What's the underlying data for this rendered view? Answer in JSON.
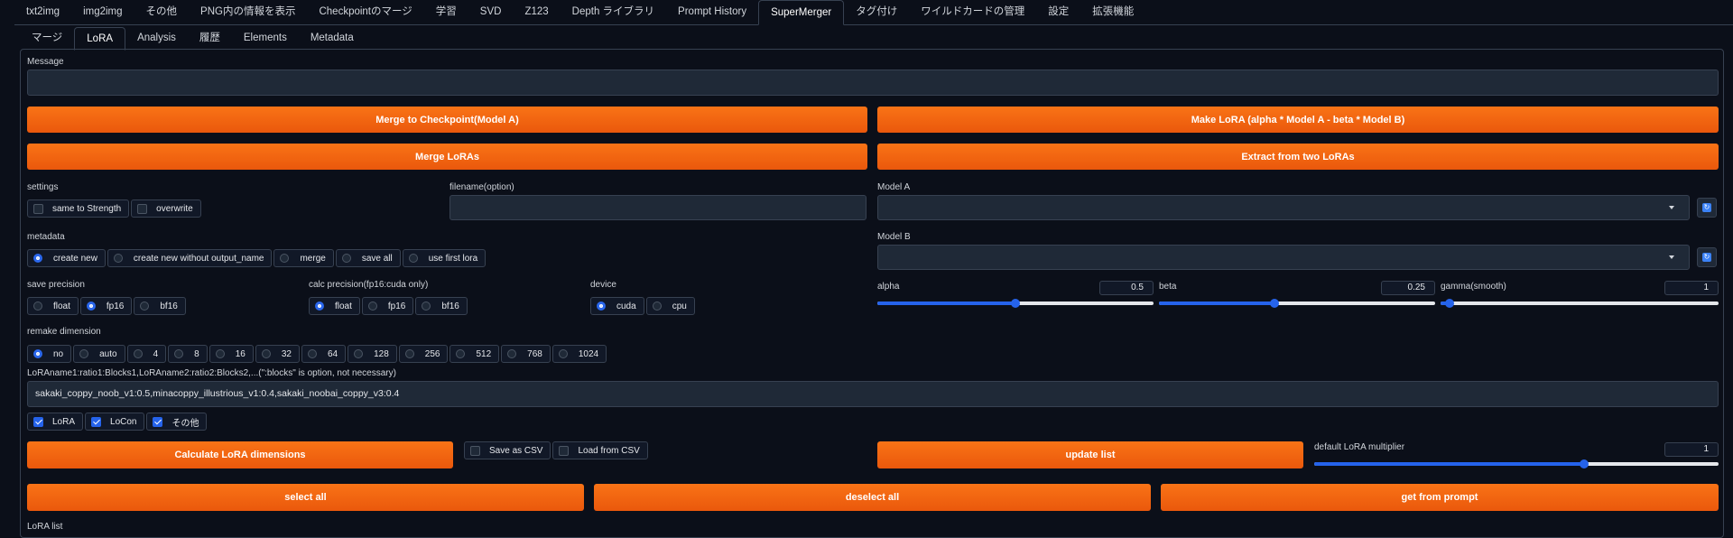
{
  "top_tabs": [
    "txt2img",
    "img2img",
    "その他",
    "PNG内の情報を表示",
    "Checkpointのマージ",
    "学習",
    "SVD",
    "Z123",
    "Depth ライブラリ",
    "Prompt History",
    "SuperMerger",
    "タグ付け",
    "ワイルドカードの管理",
    "設定",
    "拡張機能"
  ],
  "sub_tabs": [
    "マージ",
    "LoRA",
    "Analysis",
    "履歴",
    "Elements",
    "Metadata"
  ],
  "message": {
    "label": "Message",
    "value": ""
  },
  "buttons": {
    "merge_to_checkpoint": "Merge to Checkpoint(Model A)",
    "make_lora": "Make LoRA (alpha * Model A - beta * Model B)",
    "merge_loras": "Merge LoRAs",
    "extract": "Extract from two LoRAs",
    "calculate": "Calculate LoRA dimensions",
    "update_list": "update list",
    "select_all": "select all",
    "deselect_all": "deselect all",
    "get_from_prompt": "get from prompt"
  },
  "settings": {
    "label": "settings",
    "options": [
      "same to Strength",
      "overwrite"
    ]
  },
  "filename": {
    "label": "filename(option)",
    "value": ""
  },
  "model_a": {
    "label": "Model A",
    "value": ""
  },
  "model_b": {
    "label": "Model B",
    "value": ""
  },
  "metadata": {
    "label": "metadata",
    "options": [
      "create new",
      "create new without output_name",
      "merge",
      "save all",
      "use first lora"
    ],
    "selected": "create new"
  },
  "save_precision": {
    "label": "save precision",
    "options": [
      "float",
      "fp16",
      "bf16"
    ],
    "selected": "fp16"
  },
  "calc_precision": {
    "label": "calc precision(fp16:cuda only)",
    "options": [
      "float",
      "fp16",
      "bf16"
    ],
    "selected": "float"
  },
  "device": {
    "label": "device",
    "options": [
      "cuda",
      "cpu"
    ],
    "selected": "cuda"
  },
  "alpha": {
    "label": "alpha",
    "value": "0.5",
    "min": -1,
    "max": 2,
    "current": 0.5
  },
  "beta": {
    "label": "beta",
    "value": "0.25",
    "min": -1,
    "max": 2,
    "current": 0.25
  },
  "gamma": {
    "label": "gamma(smooth)",
    "value": "1",
    "min": 0,
    "max": 30,
    "current": 1
  },
  "remake_dimension": {
    "label": "remake dimension",
    "options": [
      "no",
      "auto",
      "4",
      "8",
      "16",
      "32",
      "64",
      "128",
      "256",
      "512",
      "768",
      "1024"
    ],
    "selected": "no"
  },
  "lora_input": {
    "label": "LoRAname1:ratio1:Blocks1,LoRAname2:ratio2:Blocks2,...(\":blocks\" is option, not necessary)",
    "value": "sakaki_coppy_noob_v1:0.5,minacoppy_illustrious_v1:0.4,sakaki_noobai_coppy_v3:0.4"
  },
  "type_checks": {
    "options": [
      "LoRA",
      "LoCon",
      "その他"
    ]
  },
  "csv": {
    "save": "Save as CSV",
    "load": "Load from CSV"
  },
  "default_multiplier": {
    "label": "default LoRA multiplier",
    "value": "1",
    "min": -1,
    "max": 2,
    "current": 1
  },
  "lora_list_label": "LoRA list"
}
